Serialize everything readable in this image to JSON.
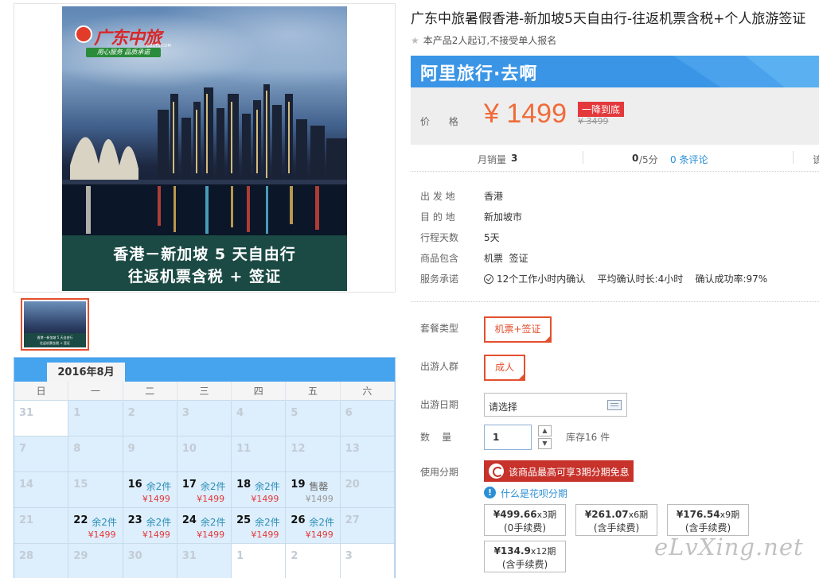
{
  "gallery": {
    "logo_text": "广东中旅",
    "logo_domain": "GDCTS.COM",
    "logo_slogan": "用心服务 品质承诺",
    "poster_line1": "香港－新加坡 5 天自由行",
    "poster_line2": "往返机票含税 + 签证"
  },
  "calendar": {
    "month": "2016年8月",
    "weekdays": [
      "日",
      "一",
      "二",
      "三",
      "四",
      "五",
      "六"
    ],
    "cells": [
      {
        "day": "31",
        "stock": "",
        "price": "",
        "available": false,
        "white": true
      },
      {
        "day": "1",
        "stock": "",
        "price": "",
        "available": false
      },
      {
        "day": "2",
        "stock": "",
        "price": "",
        "available": false
      },
      {
        "day": "3",
        "stock": "",
        "price": "",
        "available": false
      },
      {
        "day": "4",
        "stock": "",
        "price": "",
        "available": false
      },
      {
        "day": "5",
        "stock": "",
        "price": "",
        "available": false
      },
      {
        "day": "6",
        "stock": "",
        "price": "",
        "available": false
      },
      {
        "day": "7",
        "stock": "",
        "price": "",
        "available": false
      },
      {
        "day": "8",
        "stock": "",
        "price": "",
        "available": false
      },
      {
        "day": "9",
        "stock": "",
        "price": "",
        "available": false
      },
      {
        "day": "10",
        "stock": "",
        "price": "",
        "available": false
      },
      {
        "day": "11",
        "stock": "",
        "price": "",
        "available": false
      },
      {
        "day": "12",
        "stock": "",
        "price": "",
        "available": false
      },
      {
        "day": "13",
        "stock": "",
        "price": "",
        "available": false
      },
      {
        "day": "14",
        "stock": "",
        "price": "",
        "available": false
      },
      {
        "day": "15",
        "stock": "",
        "price": "",
        "available": false
      },
      {
        "day": "16",
        "stock": "余2件",
        "price": "¥1499",
        "available": true
      },
      {
        "day": "17",
        "stock": "余2件",
        "price": "¥1499",
        "available": true
      },
      {
        "day": "18",
        "stock": "余2件",
        "price": "¥1499",
        "available": true
      },
      {
        "day": "19",
        "stock": "售罄",
        "price": "¥1499",
        "available": true,
        "sold": true
      },
      {
        "day": "20",
        "stock": "",
        "price": "",
        "available": false
      },
      {
        "day": "21",
        "stock": "",
        "price": "",
        "available": false
      },
      {
        "day": "22",
        "stock": "余2件",
        "price": "¥1499",
        "available": true
      },
      {
        "day": "23",
        "stock": "余2件",
        "price": "¥1499",
        "available": true
      },
      {
        "day": "24",
        "stock": "余2件",
        "price": "¥1499",
        "available": true
      },
      {
        "day": "25",
        "stock": "余2件",
        "price": "¥1499",
        "available": true
      },
      {
        "day": "26",
        "stock": "余2件",
        "price": "¥1499",
        "available": true
      },
      {
        "day": "27",
        "stock": "",
        "price": "",
        "available": false
      },
      {
        "day": "28",
        "stock": "",
        "price": "",
        "available": false
      },
      {
        "day": "29",
        "stock": "",
        "price": "",
        "available": false
      },
      {
        "day": "30",
        "stock": "",
        "price": "",
        "available": false
      },
      {
        "day": "31",
        "stock": "",
        "price": "",
        "available": false
      },
      {
        "day": "1",
        "stock": "",
        "price": "",
        "available": false,
        "white": true
      },
      {
        "day": "2",
        "stock": "",
        "price": "",
        "available": false,
        "white": true
      },
      {
        "day": "3",
        "stock": "",
        "price": "",
        "available": false,
        "white": true
      }
    ]
  },
  "product": {
    "title": "广东中旅暑假香港-新加坡5天自由行-往返机票含税+个人旅游签证",
    "subtitle": "本产品2人起订,不接受单人报名",
    "brand": "阿里旅行·去啊",
    "price_label": "价 格",
    "price": "¥ 1499",
    "price_badge": "一降到底",
    "price_original": "¥ 3499",
    "sales_label": "月销量",
    "sales_value": "3",
    "score_value": "0",
    "score_unit": "/5分",
    "reviews": "0 条评论",
    "edge_text": "该"
  },
  "details": [
    {
      "label": "出 发 地",
      "value": "香港"
    },
    {
      "label": "目 的 地",
      "value": "新加坡市"
    },
    {
      "label": "行程天数",
      "value": "5天"
    },
    {
      "label": "商品包含",
      "value": "机票  签证"
    },
    {
      "label": "服务承诺",
      "value": "12个工作小时内确认    平均确认时长:4小时    确认成功率:97%"
    }
  ],
  "options": {
    "package_label": "套餐类型",
    "package_value": "机票+签证",
    "traveler_label": "出游人群",
    "traveler_value": "成人",
    "date_label": "出游日期",
    "date_placeholder": "请选择",
    "qty_label": "数    量",
    "qty_value": "1",
    "stock": "库存16 件",
    "installment_label": "使用分期",
    "installment_banner": "该商品最高可享3期分期免息",
    "huabei_link": "什么是花呗分期"
  },
  "plans": [
    {
      "amount": "¥499.66",
      "period": "x3期",
      "fee": "(0手续费)"
    },
    {
      "amount": "¥261.07",
      "period": "x6期",
      "fee": "(含手续费)"
    },
    {
      "amount": "¥176.54",
      "period": "x9期",
      "fee": "(含手续费)"
    },
    {
      "amount": "¥134.9",
      "period": "x12期",
      "fee": "(含手续费)"
    }
  ],
  "watermark": "eLvXing.net",
  "colors": {
    "accent": "#e4502f",
    "price": "#f06b38",
    "brand_blue": "#3a95e6",
    "link": "#2b8fd6"
  }
}
